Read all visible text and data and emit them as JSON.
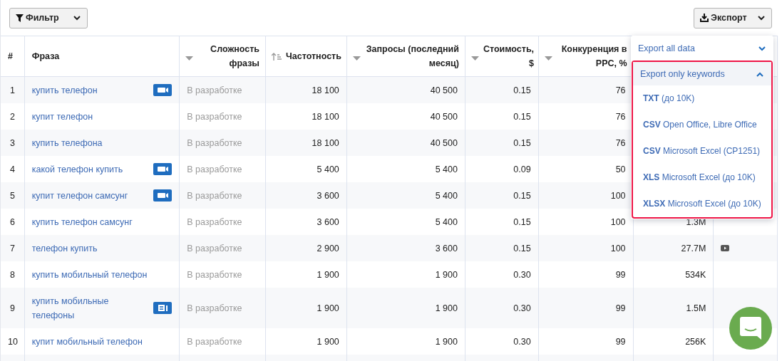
{
  "toolbar": {
    "filter_button": "Фильтр",
    "export_button": "Экспорт"
  },
  "table": {
    "columns": [
      {
        "label": "#",
        "kind": "plain"
      },
      {
        "label": "Фраза",
        "kind": "plain"
      },
      {
        "label": "Сложность фразы",
        "kind": "caret"
      },
      {
        "label": "Частотность",
        "kind": "ascending"
      },
      {
        "label": "Запросы (последний месяц)",
        "kind": "caret"
      },
      {
        "label": "Стоимость, $",
        "kind": "caret"
      },
      {
        "label": "Конкуренция в PPC, %",
        "kind": "caret"
      }
    ],
    "rows": [
      {
        "num": "1",
        "phrase": "купить телефон",
        "badge": {
          "kind": "video"
        },
        "difficulty": "В разработке",
        "frequency": "18 100",
        "requests": "40 500",
        "cost": "0.15",
        "competition": "76"
      },
      {
        "num": "2",
        "phrase": "купит телефон",
        "difficulty": "В разработке",
        "frequency": "18 100",
        "requests": "40 500",
        "cost": "0.15",
        "competition": "76"
      },
      {
        "num": "3",
        "phrase": "купить телефона",
        "difficulty": "В разработке",
        "frequency": "18 100",
        "requests": "40 500",
        "cost": "0.15",
        "competition": "76"
      },
      {
        "num": "4",
        "phrase": "какой телефон купить",
        "badge": {
          "kind": "video"
        },
        "difficulty": "В разработке",
        "frequency": "5 400",
        "requests": "5 400",
        "cost": "0.09",
        "competition": "50"
      },
      {
        "num": "5",
        "phrase": "купит телефон самсунг",
        "badge": {
          "kind": "video"
        },
        "difficulty": "В разработке",
        "frequency": "3 600",
        "requests": "5 400",
        "cost": "0.15",
        "competition": "100"
      },
      {
        "num": "6",
        "phrase": "купить телефон самсунг",
        "difficulty": "В разработке",
        "frequency": "3 600",
        "requests": "5 400",
        "cost": "0.15",
        "competition": "100",
        "column_8": "1.3M"
      },
      {
        "num": "7",
        "phrase": "телефон купить",
        "difficulty": "В разработке",
        "frequency": "2 900",
        "requests": "3 600",
        "cost": "0.15",
        "competition": "100",
        "column_8": "27.7M",
        "column_9": {
          "kind": "video"
        }
      },
      {
        "num": "8",
        "phrase": "купить мобильный телефон",
        "difficulty": "В разработке",
        "frequency": "1 900",
        "requests": "1 900",
        "cost": "0.30",
        "competition": "99",
        "column_8": "534K"
      },
      {
        "num": "9",
        "phrase": "купить мобильные телефоны",
        "badge": {
          "kind": "article"
        },
        "difficulty": "В разработке",
        "frequency": "1 900",
        "requests": "1 900",
        "cost": "0.30",
        "competition": "99",
        "column_8": "1.5M"
      },
      {
        "num": "10",
        "phrase": "купит мобильный телефон",
        "difficulty": "В разработке",
        "frequency": "1 900",
        "requests": "1 900",
        "cost": "0.30",
        "competition": "99",
        "column_8": "256K"
      }
    ]
  },
  "export_menu": {
    "sections": [
      {
        "label": "Export all data",
        "expanded": false
      },
      {
        "label": "Export only keywords",
        "expanded": true,
        "items": [
          "**TXT** (до 10K)",
          "**CSV** Open Office, Libre Office",
          "**CSV** Microsoft Excel (CP1251)",
          "**XLS** Microsoft Excel (до 10K)",
          "**XLSX** Microsoft Excel (до 10K)"
        ]
      }
    ]
  }
}
